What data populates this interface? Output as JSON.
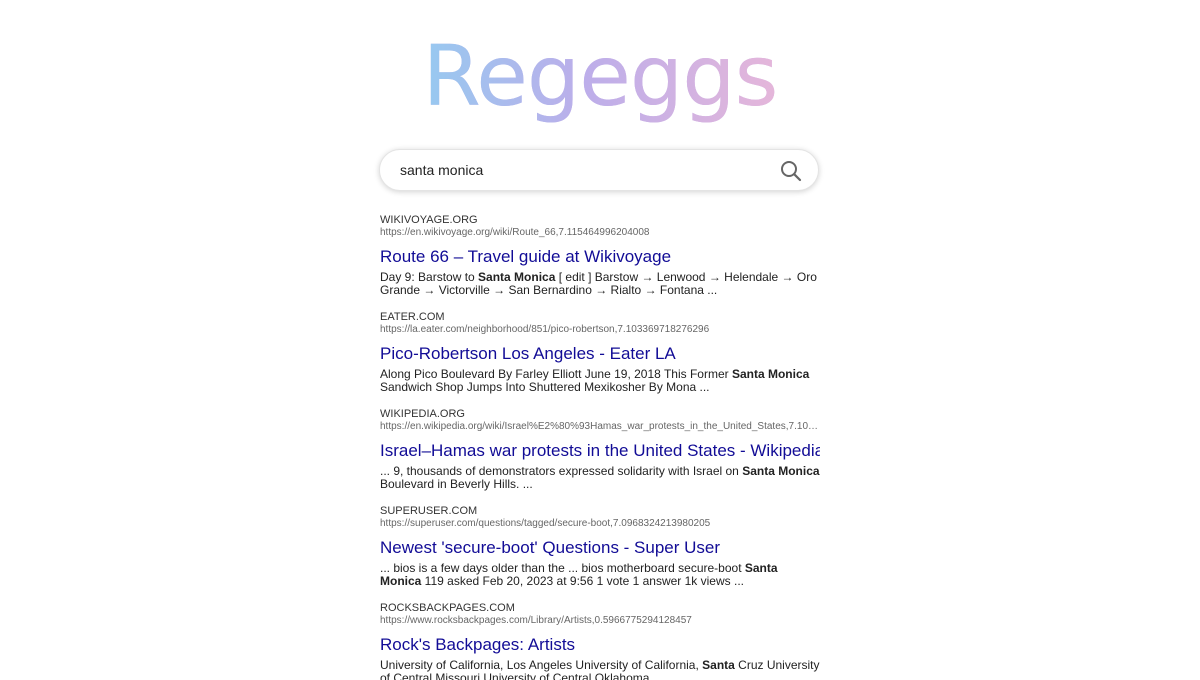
{
  "logo": {
    "text": "Regeggs"
  },
  "search": {
    "value": "santa monica",
    "icon": "search-icon"
  },
  "results": [
    {
      "domain": "WIKIVOYAGE.ORG",
      "url": "https://en.wikivoyage.org/wiki/Route_66,7.115464996204008",
      "title": "Route 66 – Travel guide at Wikivoyage",
      "snippet_parts": [
        {
          "text": "Day 9: Barstow to ",
          "bold": false
        },
        {
          "text": "Santa Monica",
          "bold": true
        },
        {
          "text": " [ edit ] Barstow → Lenwood → Helendale → Oro Grande → Victorville → San Bernardino → Rialto → Fontana ...",
          "bold": false
        }
      ]
    },
    {
      "domain": "EATER.COM",
      "url": "https://la.eater.com/neighborhood/851/pico-robertson,7.103369718276296",
      "title": "Pico-Robertson Los Angeles - Eater LA",
      "snippet_parts": [
        {
          "text": "Along Pico Boulevard By Farley Elliott June 19, 2018 This Former ",
          "bold": false
        },
        {
          "text": "Santa Monica",
          "bold": true
        },
        {
          "text": " Sandwich Shop Jumps Into Shuttered Mexikosher By Mona ...",
          "bold": false
        }
      ]
    },
    {
      "domain": "WIKIPEDIA.ORG",
      "url": "https://en.wikipedia.org/wiki/Israel%E2%80%93Hamas_war_protests_in_the_United_States,7.1022…",
      "title": "Israel–Hamas war protests in the United States - Wikipedia",
      "snippet_parts": [
        {
          "text": "... 9, thousands of demonstrators expressed solidarity with Israel on ",
          "bold": false
        },
        {
          "text": "Santa Monica",
          "bold": true
        },
        {
          "text": " Boulevard in Beverly Hills. ...",
          "bold": false
        }
      ]
    },
    {
      "domain": "SUPERUSER.COM",
      "url": "https://superuser.com/questions/tagged/secure-boot,7.0968324213980205",
      "title": "Newest 'secure-boot' Questions - Super User",
      "snippet_parts": [
        {
          "text": "... bios is a few days older than the ... bios motherboard secure-boot ",
          "bold": false
        },
        {
          "text": "Santa Monica",
          "bold": true
        },
        {
          "text": " 119 asked Feb 20, 2023 at 9:56 1 vote 1 answer 1k views ...",
          "bold": false
        }
      ]
    },
    {
      "domain": "ROCKSBACKPAGES.COM",
      "url": "https://www.rocksbackpages.com/Library/Artists,0.5966775294128457",
      "title": "Rock's Backpages: Artists",
      "snippet_parts": [
        {
          "text": "University of California, Los Angeles University of California, ",
          "bold": false
        },
        {
          "text": "Santa",
          "bold": true
        },
        {
          "text": " Cruz University of Central Missouri University of Central Oklahoma ...",
          "bold": false
        }
      ]
    }
  ]
}
